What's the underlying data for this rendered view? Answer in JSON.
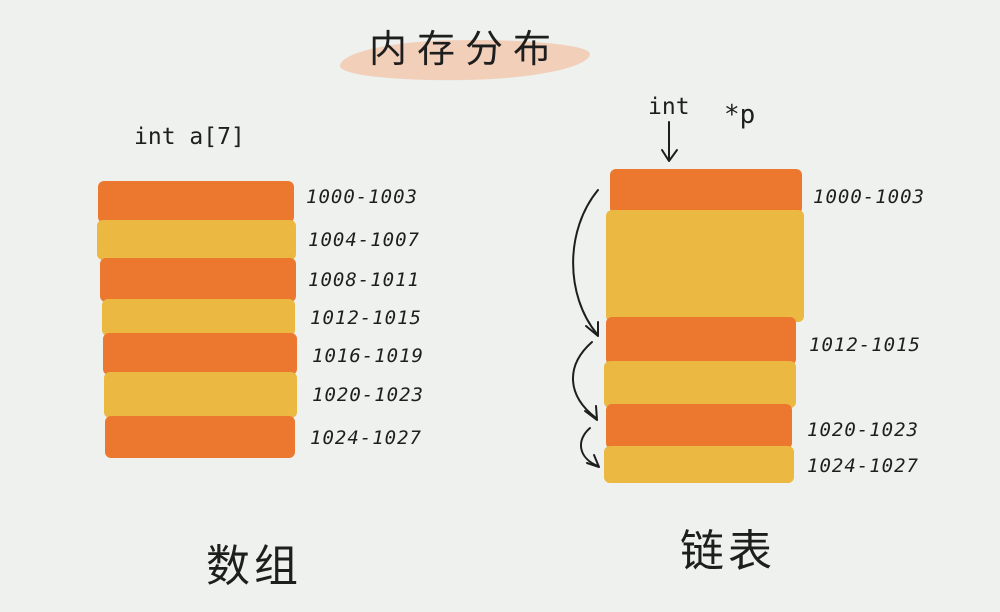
{
  "title": "内存分布",
  "array": {
    "declaration": "int a[7]",
    "caption": "数组",
    "addresses": [
      "1000-1003",
      "1004-1007",
      "1008-1011",
      "1012-1015",
      "1016-1019",
      "1020-1023",
      "1024-1027"
    ]
  },
  "linked_list": {
    "declaration_type": "int",
    "declaration_ptr": "*p",
    "caption": "链表",
    "addresses": [
      "1000-1003",
      "1012-1015",
      "1020-1023",
      "1024-1027"
    ]
  },
  "colors": {
    "orange": "#ec782f",
    "yellow": "#ebb842",
    "background": "#eef1ed",
    "title_wash": "#f3c3a7"
  }
}
